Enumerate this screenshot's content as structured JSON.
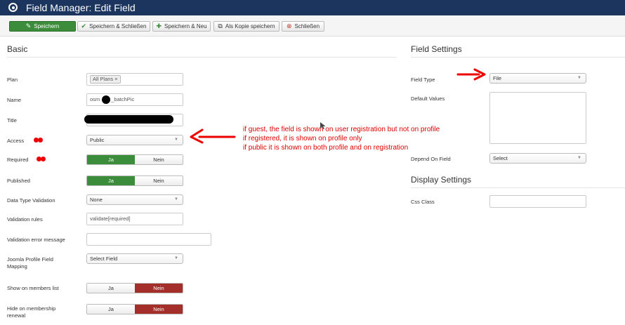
{
  "header": {
    "title": "Field Manager: Edit Field"
  },
  "toolbar": {
    "save": "Speichern",
    "save_close": "Speichern & Schließen",
    "save_new": "Speichern & Neu",
    "save_copy": "Als Kopie speichern",
    "close": "Schließen"
  },
  "basic": {
    "heading": "Basic",
    "plan_label": "Plan",
    "plan_tag": "All Plans",
    "name_label": "Name",
    "name_prefix": "osm",
    "name_suffix": "_batchPic",
    "title_label": "Title",
    "access_label": "Access",
    "access_value": "Public",
    "required_label": "Required",
    "required_yes": "Ja",
    "required_no": "Nein",
    "published_label": "Published",
    "published_yes": "Ja",
    "published_no": "Nein",
    "dtv_label": "Data Type Validation",
    "dtv_value": "None",
    "rules_label": "Validation rules",
    "rules_value": "validate[required]",
    "error_label": "Validation error message",
    "mapping_label_1": "Joomla Profile Field",
    "mapping_label_2": "Mapping",
    "mapping_value": "Select Field",
    "show_label": "Show on members list",
    "show_yes": "Ja",
    "show_no": "Nein",
    "hide_label_1": "Hide on membership",
    "hide_label_2": "renewal",
    "hide_yes": "Ja",
    "hide_no": "Nein"
  },
  "field_settings": {
    "heading": "Field Settings",
    "type_label": "Field Type",
    "type_value": "File",
    "defaults_label": "Default Values",
    "depend_label": "Depend On Field",
    "depend_value": "Select"
  },
  "display_settings": {
    "heading": "Display Settings",
    "css_label": "Css Class"
  },
  "annotation": {
    "line1": "if guest, the field is shown on user registration but not on profile",
    "line2": "if registered, it is shown on profile only",
    "line3": "if public it is shown on both profile and on registration"
  },
  "colors": {
    "header": "#1b355f",
    "success": "#3b8d3b",
    "danger": "#a42f2a",
    "annotation": "#dd0000"
  }
}
